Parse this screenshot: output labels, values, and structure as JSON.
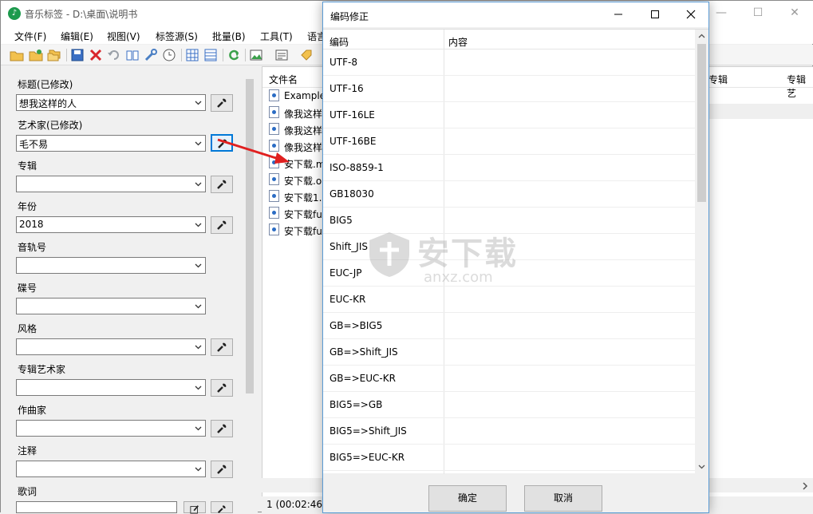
{
  "window": {
    "title": "音乐标签 - D:\\桌面\\说明书",
    "minimize": "—",
    "maximize": "☐",
    "close": "✕"
  },
  "menu": [
    "文件(F)",
    "编辑(E)",
    "视图(V)",
    "标签源(S)",
    "批量(B)",
    "工具(T)",
    "语言"
  ],
  "fields": [
    {
      "label": "标题(已修改)",
      "value": "想我这样的人",
      "has_wrench": true
    },
    {
      "label": "艺术家(已修改)",
      "value": "毛不易",
      "has_wrench": true,
      "active": true
    },
    {
      "label": "专辑",
      "value": "",
      "has_wrench": true
    },
    {
      "label": "年份",
      "value": "2018",
      "has_wrench": true
    },
    {
      "label": "音轨号",
      "value": "",
      "has_wrench": false
    },
    {
      "label": "碟号",
      "value": "",
      "has_wrench": false
    },
    {
      "label": "风格",
      "value": "",
      "has_wrench": true
    },
    {
      "label": "专辑艺术家",
      "value": "",
      "has_wrench": true
    },
    {
      "label": "作曲家",
      "value": "",
      "has_wrench": true
    },
    {
      "label": "注释",
      "value": "",
      "has_wrench": true
    },
    {
      "label": "歌词",
      "value": "",
      "has_wrench": true
    }
  ],
  "filelist": {
    "header_name": "文件名",
    "header_album": "专辑",
    "header_album_artist": "专辑艺",
    "files": [
      "Example.",
      "像我这样",
      "像我这样",
      "像我这样",
      "安下载.m",
      "安下载.o",
      "安下载1.",
      "安下载fu",
      "安下载fu"
    ]
  },
  "status": {
    "text": "1 (00:02:46"
  },
  "dialog": {
    "title": "编码修正",
    "col_encoding": "编码",
    "col_content": "内容",
    "encodings": [
      "UTF-8",
      "UTF-16",
      "UTF-16LE",
      "UTF-16BE",
      "ISO-8859-1",
      "GB18030",
      "BIG5",
      "Shift_JIS",
      "EUC-JP",
      "EUC-KR",
      "GB=>BIG5",
      "GB=>Shift_JIS",
      "GB=>EUC-KR",
      "BIG5=>GB",
      "BIG5=>Shift_JIS",
      "BIG5=>EUC-KR"
    ],
    "ok": "确定",
    "cancel": "取消"
  },
  "watermark": {
    "text": "安下载",
    "sub": "anxz.com"
  }
}
